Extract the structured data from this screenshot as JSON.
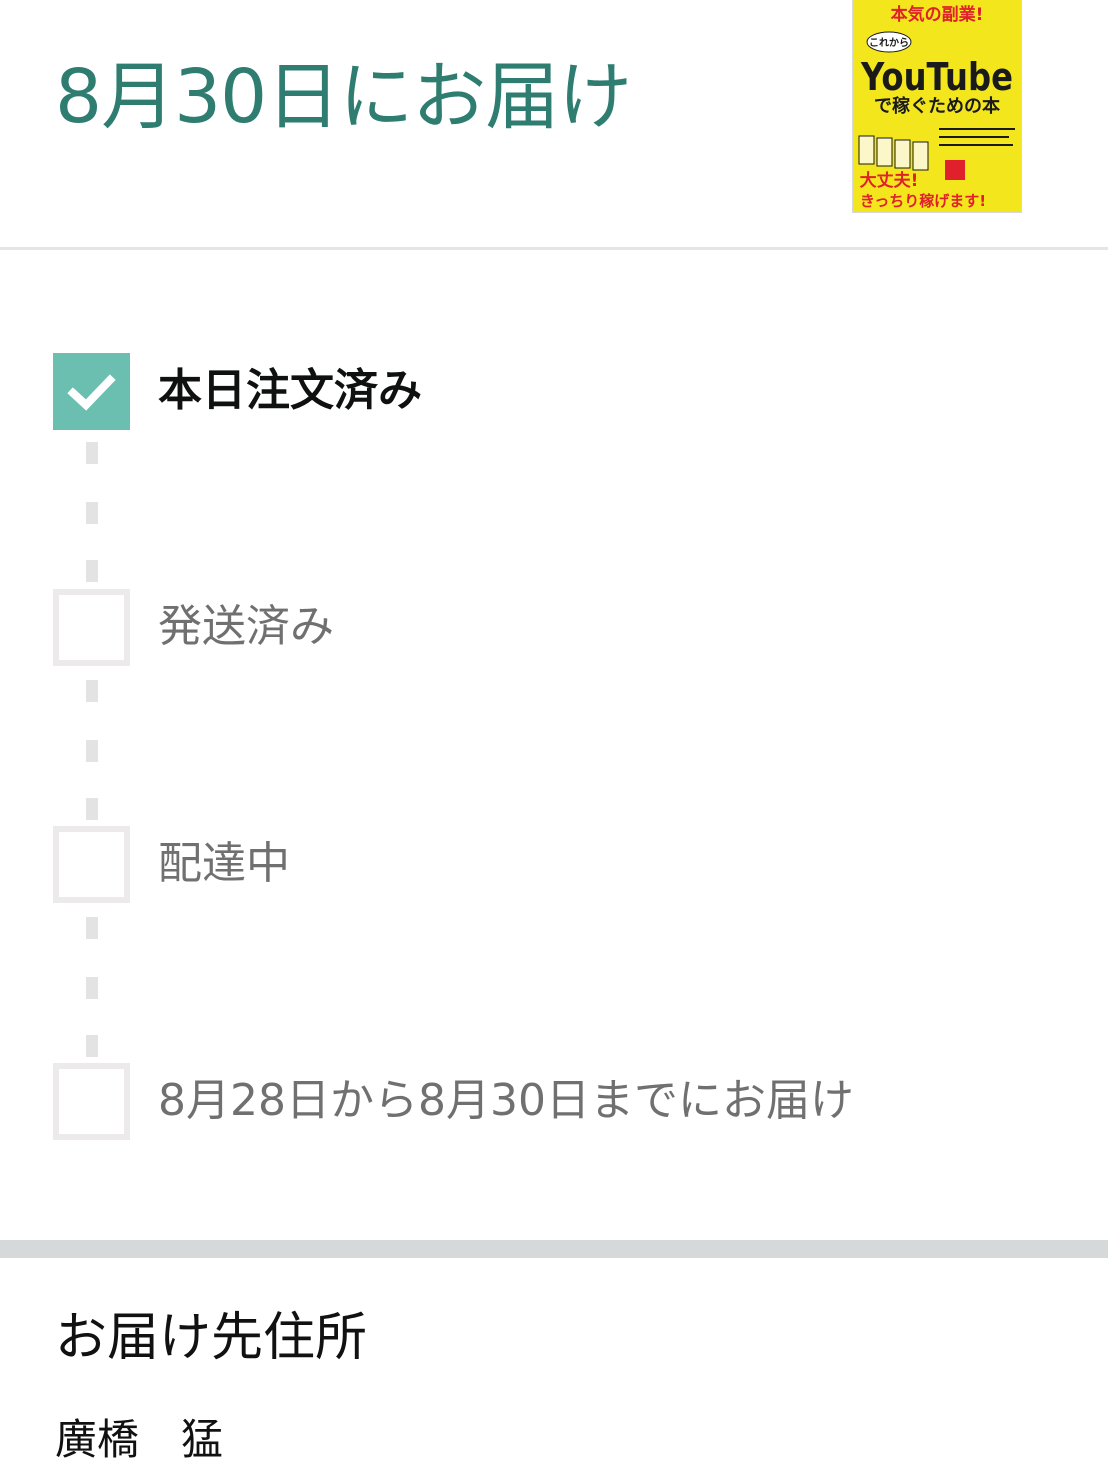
{
  "header": {
    "delivery_title": "8月30日にお届け",
    "product_cover": {
      "top_band": "本気の副業!",
      "kicker": "これから",
      "main_word": "YouTube",
      "subtitle": "で稼ぐための本",
      "bottom_line_1": "大丈夫!",
      "bottom_line_2": "きっちり稼げます!",
      "colors": {
        "background": "#f3e61d",
        "top_band": "#e0202a",
        "title": "#1a1a1a"
      }
    }
  },
  "tracker": {
    "steps": [
      {
        "label": "本日注文済み",
        "status": "done",
        "icon": "check-icon"
      },
      {
        "label": "発送済み",
        "status": "pending"
      },
      {
        "label": "配達中",
        "status": "pending"
      },
      {
        "label": "8月28日から8月30日までにお届け",
        "status": "pending"
      }
    ],
    "colors": {
      "done": "#6abfb0",
      "pending_border": "#eceaea",
      "title_accent": "#2e7d70"
    }
  },
  "address": {
    "heading": "お届け先住所",
    "name": "廣橋　猛"
  }
}
